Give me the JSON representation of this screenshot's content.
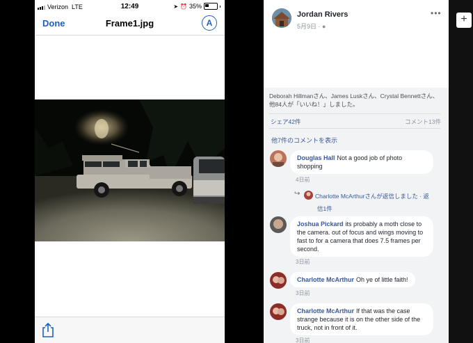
{
  "phone": {
    "carrier": "Verizon",
    "network": "LTE",
    "time": "12:49",
    "battery": "35%",
    "nav": {
      "done": "Done",
      "title": "Frame1.jpg",
      "markup_icon": "markup-pen-icon"
    },
    "toolbar": {
      "share_icon": "share-icon"
    }
  },
  "post": {
    "author": "Jordan Rivers",
    "date": "5月9日 · ",
    "reactions_text": "Deborah Hillmanさん、James Luskさん、Crystal Bennettさん、他84人が「いいね！」しました。",
    "shares": "シェア42件",
    "comment_count": "コメント13件",
    "view_more": "他7件のコメントを表示"
  },
  "comments": [
    {
      "name": "Douglas Hall",
      "text": "Not a good job of photo shopping",
      "time": "4日前",
      "reply": {
        "line1": "Charlotte McArthurさんが返信しました · 返",
        "line2": "信1件"
      }
    },
    {
      "name": "Joshua Pickard",
      "text": "its probably a moth close to the camera. out of focus and wings moving to fast to for a camera that does 7.5 frames per second.",
      "time": "3日前"
    },
    {
      "name": "Charlotte McArthur",
      "text": "Oh ye of little faith!",
      "time": "3日前"
    },
    {
      "name": "Charlotte McArthur",
      "text": "If that was the case strange because it is on the other side of the truck, not in front of it.",
      "time": "3日前"
    }
  ],
  "colors": {
    "link": "#385898",
    "ios_blue": "#1b5fc4",
    "fb_bg": "#f2f3f5"
  }
}
